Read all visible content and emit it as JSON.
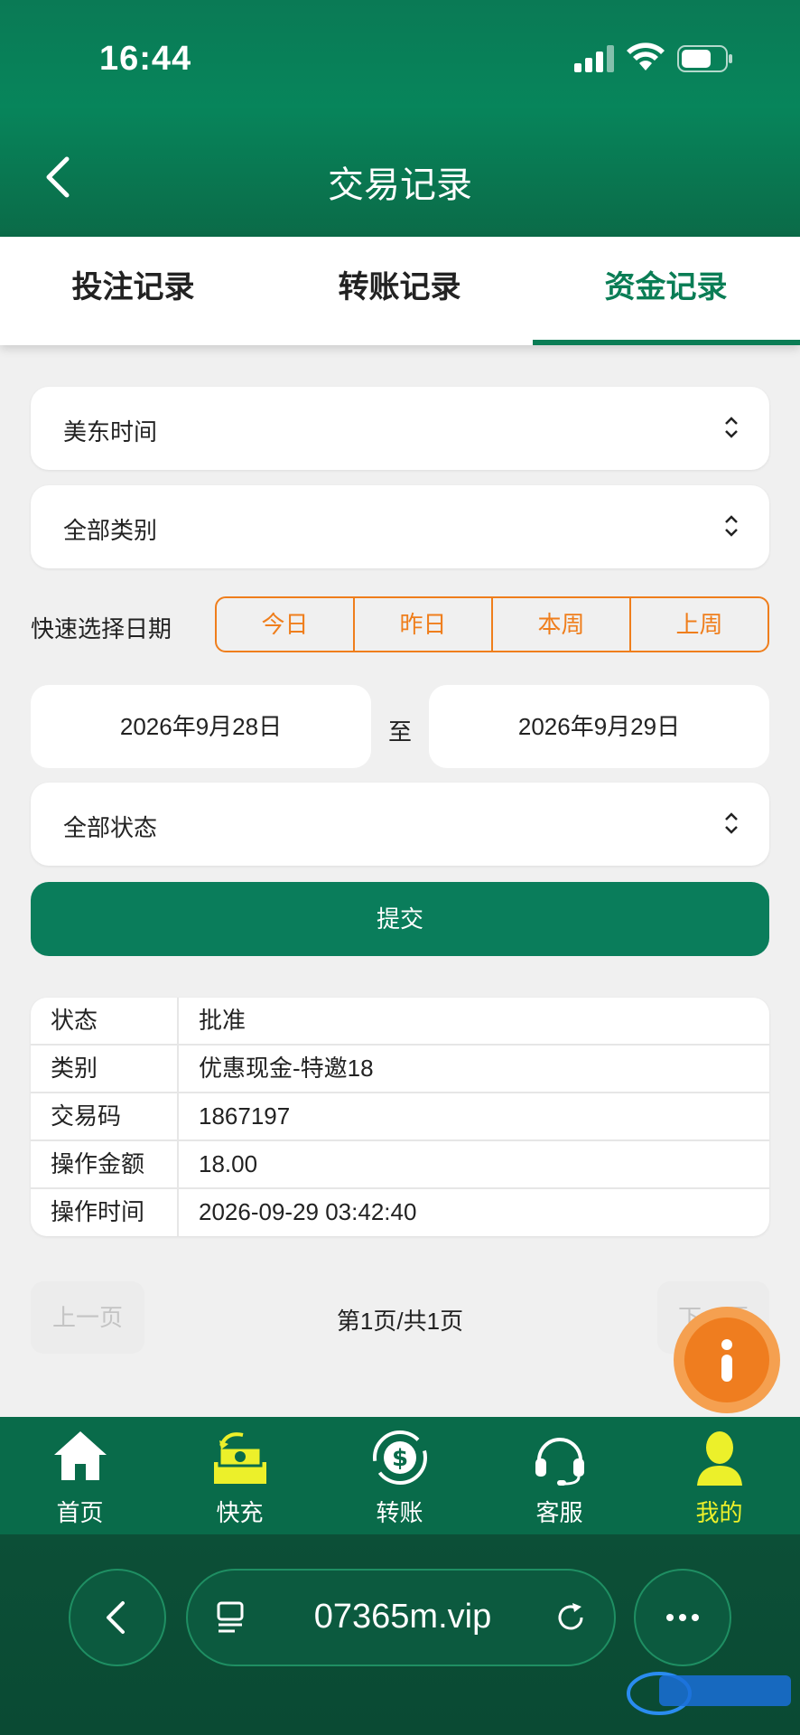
{
  "status_bar": {
    "time": "16:44"
  },
  "header": {
    "title": "交易记录"
  },
  "tabs": [
    {
      "label": "投注记录"
    },
    {
      "label": "转账记录"
    },
    {
      "label": "资金记录",
      "active": true
    }
  ],
  "filters": {
    "timezone": "美东时间",
    "category": "全部类别",
    "quick_label": "快速选择日期",
    "quick_options": [
      "今日",
      "昨日",
      "本周",
      "上周"
    ],
    "date_from": "2026年9月28日",
    "date_sep": "至",
    "date_to": "2026年9月29日",
    "status": "全部状态",
    "submit": "提交"
  },
  "record": [
    {
      "key": "状态",
      "value": "批准"
    },
    {
      "key": "类别",
      "value": "优惠现金-特邀18"
    },
    {
      "key": "交易码",
      "value": "1867197"
    },
    {
      "key": "操作金额",
      "value": "18.00"
    },
    {
      "key": "操作时间",
      "value": "2026-09-29 03:42:40"
    }
  ],
  "pager": {
    "prev": "上一页",
    "info": "第1页/共1页",
    "next": "下一页"
  },
  "bottom_nav": [
    {
      "label": "首页",
      "icon": "home-icon"
    },
    {
      "label": "快充",
      "icon": "cash-icon"
    },
    {
      "label": "转账",
      "icon": "transfer-icon"
    },
    {
      "label": "客服",
      "icon": "headset-icon"
    },
    {
      "label": "我的",
      "icon": "user-icon",
      "active": true
    }
  ],
  "browser": {
    "url": "07365m.vip"
  },
  "colors": {
    "primary": "#0a7d55",
    "accent": "#ef7e1c",
    "nav_active": "#ecf02a"
  }
}
